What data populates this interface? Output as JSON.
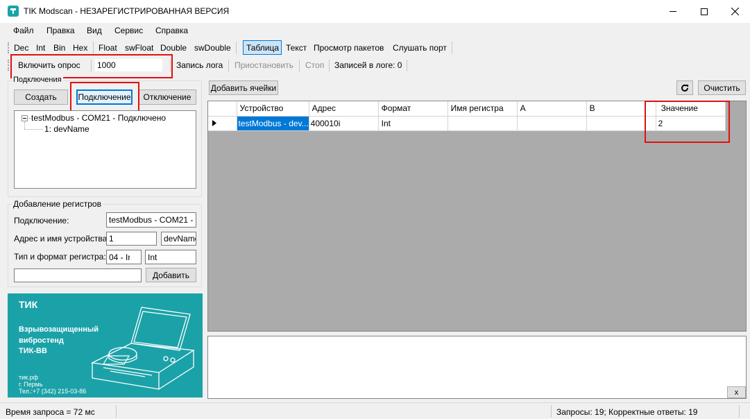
{
  "window": {
    "title": "TIK Modscan - НЕЗАРЕГИСТРИРОВАННАЯ ВЕРСИЯ",
    "min": "—",
    "max": "☐",
    "close": "✕"
  },
  "menu": [
    "Файл",
    "Правка",
    "Вид",
    "Сервис",
    "Справка"
  ],
  "toolbar1": {
    "formats": [
      "Dec",
      "Int",
      "Bin",
      "Hex",
      "Float",
      "swFloat",
      "Double",
      "swDouble"
    ],
    "views": [
      "Таблица",
      "Текст",
      "Просмотр пакетов",
      "Слушать порт"
    ]
  },
  "toolbar2": {
    "poll_label": "Включить опрос",
    "poll_interval": "1000",
    "log_record": "Запись лога",
    "pause": "Приостановить",
    "stop": "Стоп",
    "log_count": "Записей в логе: 0"
  },
  "connections": {
    "title": "Подключения",
    "create": "Создать",
    "connect": "Подключение",
    "disconnect": "Отключение",
    "tree_root": "testModbus - COM21 - Подключено",
    "tree_child": "1: devName"
  },
  "add_registers": {
    "title": "Добавление регистров",
    "connection_label": "Подключение:",
    "connection_value": "testModbus - COM21 -",
    "address_label": "Адрес и имя устройства:",
    "address_value": "1",
    "device_name": "devName",
    "type_label": "Тип и формат регистра:",
    "type_value": "04 - Ir",
    "format_value": "Int",
    "add_button": "Добавить"
  },
  "ad": {
    "logo": "ТИК",
    "line1": "Взрывозащищенный",
    "line2": "вибростенд",
    "line3": "ТИК-ВВ",
    "site": "тик.рф",
    "city": "г. Пермь",
    "phone": "Тел.:+7 (342) 215-03-86"
  },
  "grid": {
    "add_cells": "Добавить ячейки",
    "refresh_icon": "refresh-icon",
    "clear": "Очистить",
    "columns": [
      "Устройство",
      "Адрес",
      "Формат",
      "Имя регистра",
      "A",
      "B",
      "Значение"
    ],
    "rows": [
      [
        "testModbus - dev...",
        "400010i",
        "Int",
        "",
        "",
        "",
        "2"
      ]
    ]
  },
  "log_close": "x",
  "status": {
    "request_time": "Время запроса = 72 мс",
    "stats": "Запросы: 19; Корректные ответы: 19"
  },
  "colors": {
    "selection": "#0078d7",
    "ad_bg": "#1ba2a8",
    "highlight": "#e01010",
    "grid_bg": "#ababab"
  }
}
